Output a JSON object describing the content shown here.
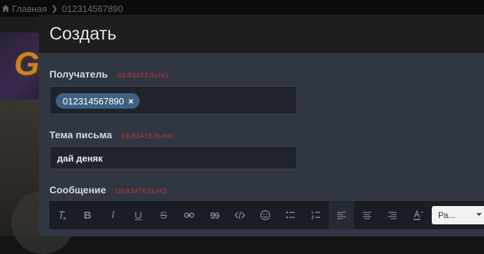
{
  "breadcrumb": {
    "home_label": "Главная",
    "current": "012314567890"
  },
  "background": {
    "logo_letter": "G"
  },
  "modal": {
    "title": "Создать",
    "recipient": {
      "label": "Получатель",
      "required": "ОБЯЗАТЕЛЬНО",
      "token": "012314567890",
      "remove_glyph": "×"
    },
    "subject": {
      "label": "Тема письма",
      "required": "ОБЯЗАТЕЛЬНО",
      "value": "дай деняк"
    },
    "message": {
      "label": "Сообщение",
      "required": "ОБЯЗАТЕЛЬНО"
    },
    "toolbar": {
      "buttons": [
        "clear-format",
        "bold",
        "italic",
        "underline",
        "strikethrough",
        "link",
        "quote",
        "code",
        "emoji",
        "bulleted-list",
        "numbered-list",
        "align-left",
        "align-center",
        "align-right",
        "text-color"
      ],
      "bold_glyph": "B",
      "italic_glyph": "I",
      "underline_glyph": "U",
      "strike_glyph": "S",
      "quote_glyph": "99",
      "font_select_value": "Ра..."
    }
  },
  "colors": {
    "accent": "#3f6080",
    "required": "#c23a3a",
    "modal_body": "#303642",
    "input_bg": "#1f232b"
  }
}
